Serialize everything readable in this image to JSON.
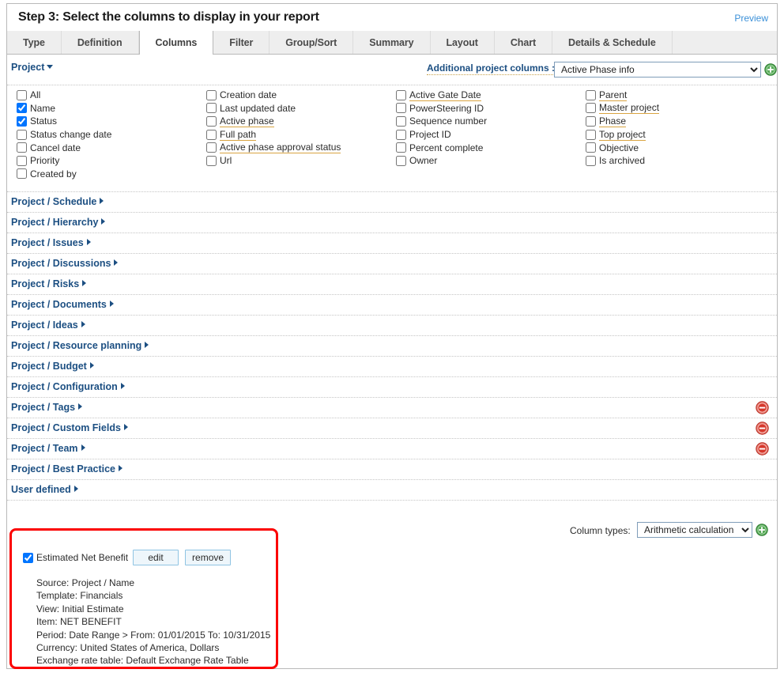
{
  "header": {
    "title": "Step 3: Select the columns to display in your report",
    "preview_label": "Preview"
  },
  "tabs": [
    {
      "label": "Type",
      "active": false
    },
    {
      "label": "Definition",
      "active": false
    },
    {
      "label": "Columns",
      "active": true
    },
    {
      "label": "Filter",
      "active": false
    },
    {
      "label": "Group/Sort",
      "active": false
    },
    {
      "label": "Summary",
      "active": false
    },
    {
      "label": "Layout",
      "active": false
    },
    {
      "label": "Chart",
      "active": false
    },
    {
      "label": "Details & Schedule",
      "active": false
    }
  ],
  "toolbar": {
    "group_label": "Project",
    "additional_columns_label": "Additional project columns :",
    "additional_columns_value": "Active Phase info",
    "additional_columns_options": [
      "Active Phase info"
    ],
    "add_icon": "plus-circle-icon"
  },
  "columns_grid": [
    [
      {
        "label": "All",
        "checked": false,
        "highlighted": false
      },
      {
        "label": "Name",
        "checked": true,
        "highlighted": false
      },
      {
        "label": "Status",
        "checked": true,
        "highlighted": false
      },
      {
        "label": "Status change date",
        "checked": false,
        "highlighted": false
      },
      {
        "label": "Cancel date",
        "checked": false,
        "highlighted": false
      },
      {
        "label": "Priority",
        "checked": false,
        "highlighted": false
      },
      {
        "label": "Created by",
        "checked": false,
        "highlighted": false
      }
    ],
    [
      {
        "label": "Creation date",
        "checked": false,
        "highlighted": false
      },
      {
        "label": "Last updated date",
        "checked": false,
        "highlighted": false
      },
      {
        "label": "Active phase",
        "checked": false,
        "highlighted": true
      },
      {
        "label": "Full path",
        "checked": false,
        "highlighted": true
      },
      {
        "label": "Active phase approval status",
        "checked": false,
        "highlighted": true
      },
      {
        "label": "Url",
        "checked": false,
        "highlighted": false
      }
    ],
    [
      {
        "label": "Active Gate Date",
        "checked": false,
        "highlighted": true
      },
      {
        "label": "PowerSteering ID",
        "checked": false,
        "highlighted": false
      },
      {
        "label": "Sequence number",
        "checked": false,
        "highlighted": false
      },
      {
        "label": "Project ID",
        "checked": false,
        "highlighted": false
      },
      {
        "label": "Percent complete",
        "checked": false,
        "highlighted": false
      },
      {
        "label": "Owner",
        "checked": false,
        "highlighted": false
      }
    ],
    [
      {
        "label": "Parent",
        "checked": false,
        "highlighted": true
      },
      {
        "label": "Master project",
        "checked": false,
        "highlighted": true
      },
      {
        "label": "Phase",
        "checked": false,
        "highlighted": true
      },
      {
        "label": "Top project",
        "checked": false,
        "highlighted": true
      },
      {
        "label": "Objective",
        "checked": false,
        "highlighted": false
      },
      {
        "label": "Is archived",
        "checked": false,
        "highlighted": false
      }
    ]
  ],
  "sections": [
    {
      "label": "Project / Schedule",
      "removable": false
    },
    {
      "label": "Project / Hierarchy",
      "removable": false
    },
    {
      "label": "Project / Issues",
      "removable": false
    },
    {
      "label": "Project / Discussions",
      "removable": false
    },
    {
      "label": "Project / Risks",
      "removable": false
    },
    {
      "label": "Project / Documents",
      "removable": false
    },
    {
      "label": "Project / Ideas",
      "removable": false
    },
    {
      "label": "Project / Resource planning",
      "removable": false
    },
    {
      "label": "Project / Budget",
      "removable": false
    },
    {
      "label": "Project / Configuration",
      "removable": false
    },
    {
      "label": "Project / Tags",
      "removable": true
    },
    {
      "label": "Project / Custom Fields",
      "removable": true
    },
    {
      "label": "Project / Team",
      "removable": true
    },
    {
      "label": "Project / Best Practice",
      "removable": false
    },
    {
      "label": "User defined",
      "removable": false
    }
  ],
  "column_types": {
    "label": "Column types:",
    "value": "Arithmetic calculation",
    "options": [
      "Arithmetic calculation"
    ],
    "add_icon": "plus-circle-icon"
  },
  "custom_column": {
    "checked": true,
    "title": "Estimated Net Benefit",
    "edit_label": "edit",
    "remove_label": "remove",
    "details": [
      "Source: Project / Name",
      "Template: Financials",
      "View: Initial Estimate",
      "Item: NET BENEFIT",
      "Period: Date Range > From: 01/01/2015 To: 10/31/2015",
      "Currency: United States of America, Dollars",
      "Exchange rate table: Default Exchange Rate Table"
    ]
  },
  "colors": {
    "link_blue": "#1c4f82",
    "preview_blue": "#3b90d8",
    "highlight_underline": "#d9a441",
    "callout_red": "#fb0000",
    "remove_icon_red": "#d8453b",
    "add_icon_green": "#3f9f3f",
    "tab_inactive_bg": "#eeeeee"
  }
}
